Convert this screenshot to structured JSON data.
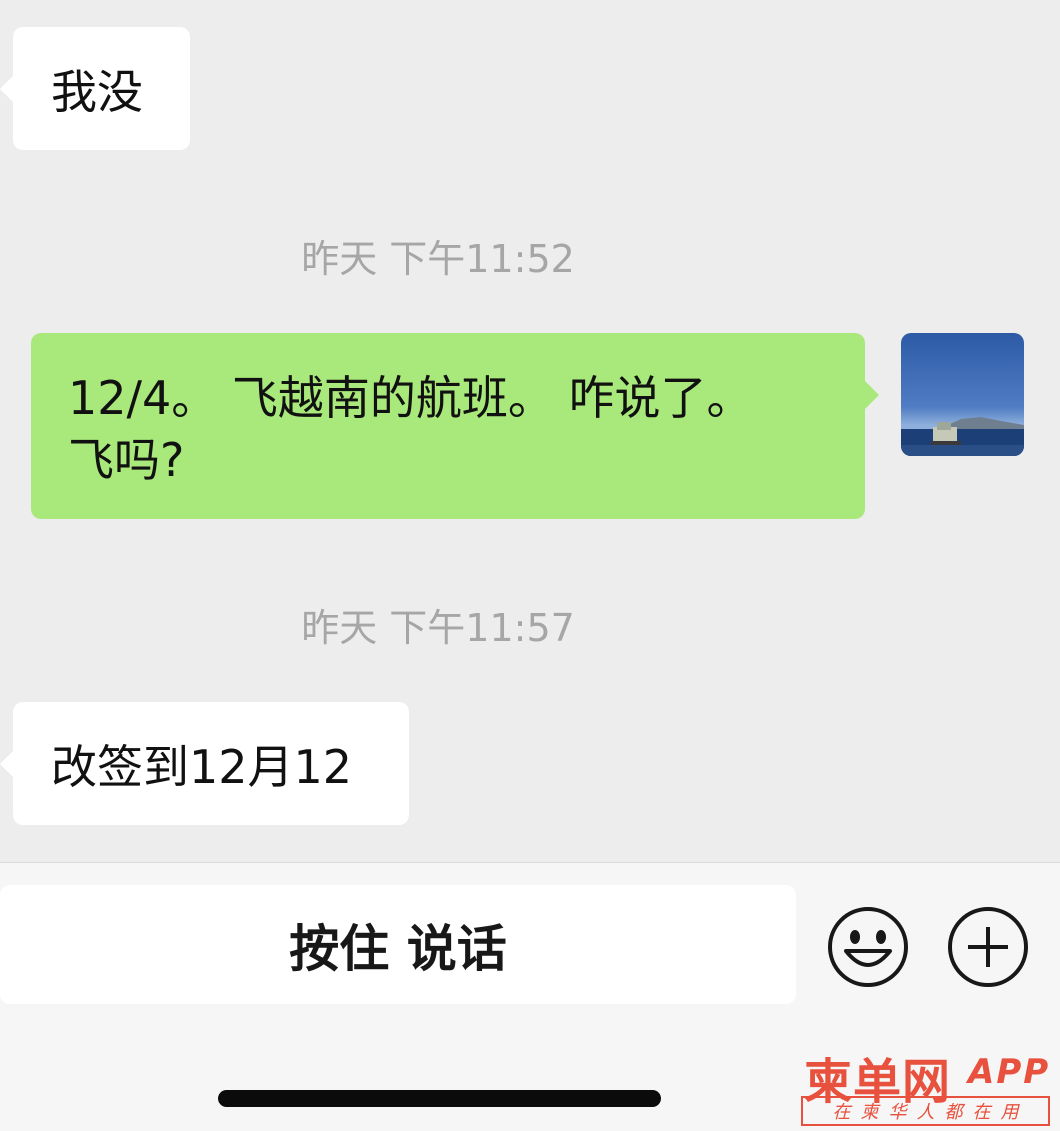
{
  "chat": {
    "msg1": "我没",
    "time1": "昨天 下午11:52",
    "msg2_line1": "12/4。 飞越南的航班。 咋说了。",
    "msg2_line2": "飞吗?",
    "time2": "昨天 下午11:57",
    "msg3": "改签到12月12"
  },
  "input_bar": {
    "voice_label": "按住 说话",
    "emoji_icon": "smiley-icon",
    "more_icon": "plus-circle-icon"
  },
  "watermark": {
    "title": "柬单网",
    "app": "APP",
    "subtitle": "在柬华人都在用"
  },
  "colors": {
    "background": "#ededed",
    "incoming_bubble": "#ffffff",
    "outgoing_bubble": "#a9e97b",
    "timestamp": "#a6a6a6",
    "watermark": "#e8513e"
  }
}
